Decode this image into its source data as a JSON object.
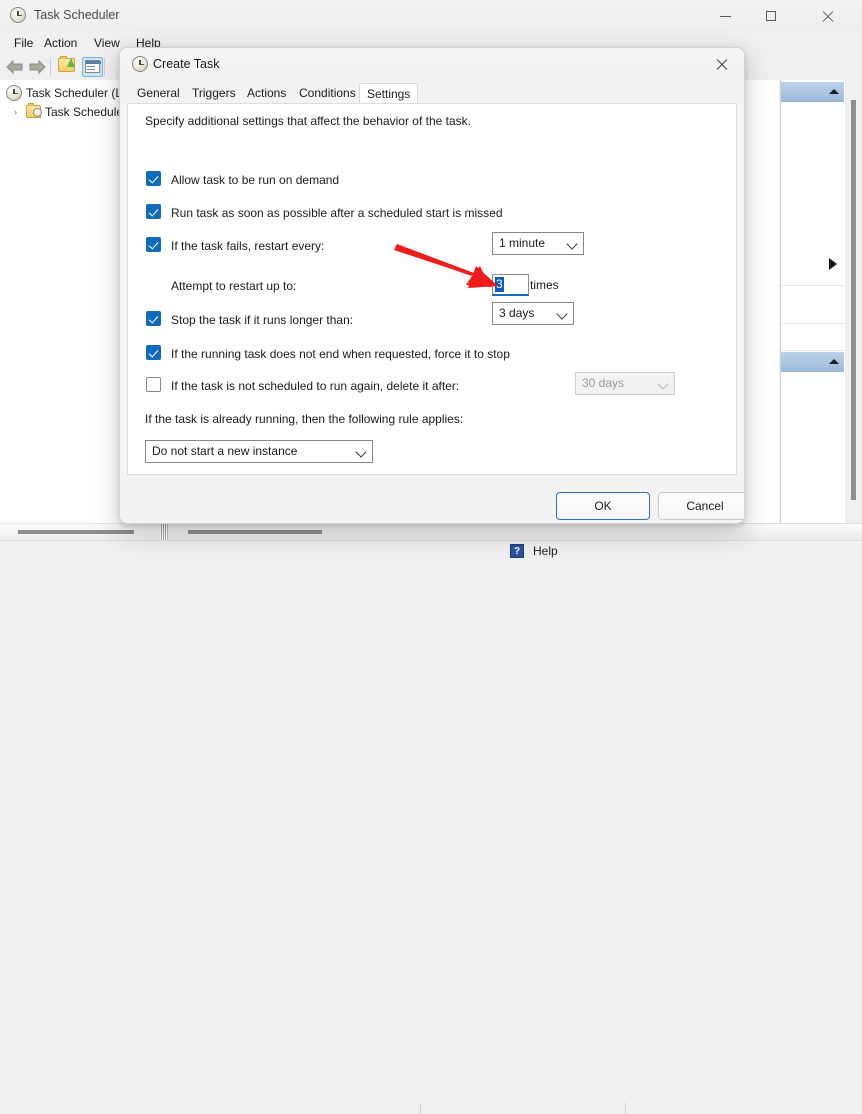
{
  "window": {
    "title": "Task Scheduler",
    "icon": "clock-icon",
    "controls": {
      "minimize": "–",
      "maximize": "□",
      "close": "✕"
    },
    "menu": [
      "File",
      "Action",
      "View",
      "Help"
    ],
    "toolbar": {
      "back": "◀",
      "forward": "▶",
      "show_hide_tree": "folder-icon",
      "properties": "properties-icon"
    },
    "tree": [
      {
        "label": "Task Scheduler (L",
        "icon": "clock-icon",
        "expander": ""
      },
      {
        "label": "Task Schedule",
        "icon": "task-folder-icon",
        "expander": "›"
      }
    ],
    "actions_pane": {
      "help_label": "Help",
      "help_icon": "question-icon"
    }
  },
  "dialog": {
    "title": "Create Task",
    "icon": "clock-icon",
    "close_label": "✕",
    "tabs": [
      {
        "label": "General",
        "selected": false
      },
      {
        "label": "Triggers",
        "selected": false
      },
      {
        "label": "Actions",
        "selected": false
      },
      {
        "label": "Conditions",
        "selected": false
      },
      {
        "label": "Settings",
        "selected": true
      }
    ],
    "intro": "Specify additional settings that affect the behavior of the task.",
    "settings": [
      {
        "label": "Allow task to be run on demand",
        "checked": true
      },
      {
        "label": "Run task as soon as possible after a scheduled start is missed",
        "checked": true
      },
      {
        "label": "If the task fails, restart every:",
        "checked": true
      },
      {
        "label": "Stop the task if it runs longer than:",
        "checked": true
      },
      {
        "label": "If the running task does not end when requested, force it to stop",
        "checked": true
      },
      {
        "label": "If the task is not scheduled to run again, delete it after:",
        "checked": false
      }
    ],
    "restart_every_value": "1 minute",
    "attempt_label": "Attempt to restart up to:",
    "attempt_value": "3",
    "times_label": "times",
    "stop_after_value": "3 days",
    "delete_after_value": "30 days",
    "rule_label": "If the task is already running, then the following rule applies:",
    "instance_rule_value": "Do not start a new instance",
    "ok_label": "OK",
    "cancel_label": "Cancel"
  },
  "annotation": {
    "arrow_color": "#f01c1c",
    "points_to": "attempt-to-restart-input"
  }
}
